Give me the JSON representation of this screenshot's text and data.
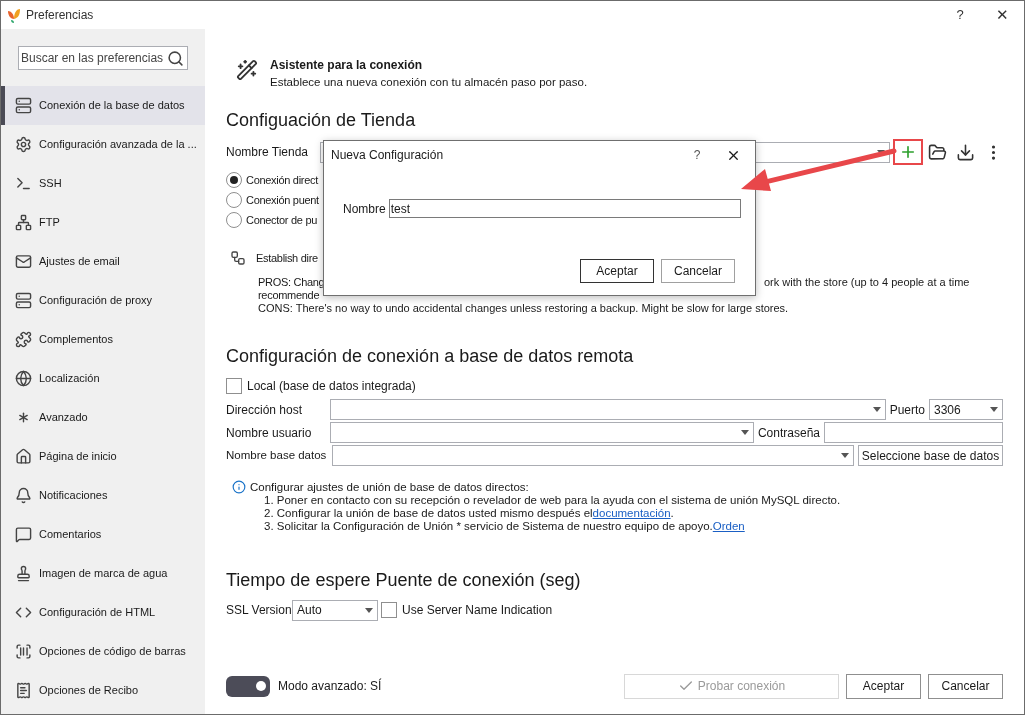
{
  "window": {
    "title": "Preferencias",
    "help": "?",
    "close": "✕"
  },
  "sidebar": {
    "search": {
      "placeholder": "Buscar en las preferencias"
    },
    "items": [
      {
        "label": "Conexión de la base de datos",
        "selected": true
      },
      {
        "label": "Configuración avanzada de la ...",
        "selected": false
      },
      {
        "label": "SSH",
        "selected": false
      },
      {
        "label": "FTP",
        "selected": false
      },
      {
        "label": "Ajustes de email",
        "selected": false
      },
      {
        "label": "Configuración de proxy",
        "selected": false
      },
      {
        "label": "Complementos",
        "selected": false
      },
      {
        "label": "Localización",
        "selected": false
      },
      {
        "label": "Avanzado",
        "selected": false
      },
      {
        "label": "Página de inicio",
        "selected": false
      },
      {
        "label": "Notificaciones",
        "selected": false
      },
      {
        "label": "Comentarios",
        "selected": false
      },
      {
        "label": "Imagen de marca de agua",
        "selected": false
      },
      {
        "label": "Configuración de HTML",
        "selected": false
      },
      {
        "label": "Opciones de código de barras",
        "selected": false
      },
      {
        "label": "Opciones de Recibo",
        "selected": false
      }
    ]
  },
  "wizard": {
    "title": "Asistente para la conexión",
    "subtitle": "Establece una nueva conexión con tu almacén paso por paso."
  },
  "store": {
    "heading": "Configuación de Tienda",
    "name_label": "Nombre Tienda",
    "connection_types": [
      {
        "label": "Conexión direct",
        "selected": true
      },
      {
        "label": "Conexión puent",
        "selected": false
      },
      {
        "label": "Conector de pu",
        "selected": false
      }
    ],
    "description_title": "Establish dire",
    "pros_left": "PROS: Chang",
    "pros_right": "ork with the store (up to 4 people at a time",
    "pros_cont": "recommende",
    "cons": "CONS: There's no way to undo accidental changes unless restoring a backup. Might be slow for large stores."
  },
  "dialog": {
    "title": "Nueva Configuración",
    "help": "?",
    "name_label": "Nombre",
    "name_value": "test",
    "buttons": [
      {
        "label": "Aceptar",
        "default": true
      },
      {
        "label": "Cancelar",
        "default": false
      }
    ]
  },
  "remote": {
    "heading": "Configuración de conexión a base de datos remota",
    "local": {
      "label": "Local (base de datos integrada)",
      "checked": false
    },
    "host_label": "Dirección host",
    "port_label": "Puerto",
    "port_value": "3306",
    "user_label": "Nombre usuario",
    "password_label": "Contraseña",
    "db_label": "Nombre base datos",
    "select_db_button": "Seleccione base de datos",
    "info": {
      "title": "Configurar ajustes de unión de base de datos directos:",
      "steps": [
        {
          "text": "1. Poner en contacto con su recepción o revelador de web para la ayuda con el sistema de unión MySQL directo."
        },
        {
          "text": "2. Configurar la unión de base de datos usted mismo después el",
          "link": "documentación",
          "after": "."
        },
        {
          "text": "3. Solicitar la Configuración de Unión * servicio de Sistema de nuestro equipo de apoyo.",
          "link": "Orden"
        }
      ]
    }
  },
  "timeout": {
    "heading": "Tiempo de espere Puente de conexión (seg)",
    "ssl_label": "SSL Version",
    "ssl_value": "Auto",
    "sni": {
      "label": "Use Server Name Indication",
      "checked": false
    }
  },
  "footer": {
    "advanced": {
      "label": "Modo avanzado: SÍ",
      "on": true
    },
    "test": {
      "label": "Probar conexión",
      "disabled": true
    },
    "buttons": [
      "Aceptar",
      "Cancelar"
    ]
  }
}
